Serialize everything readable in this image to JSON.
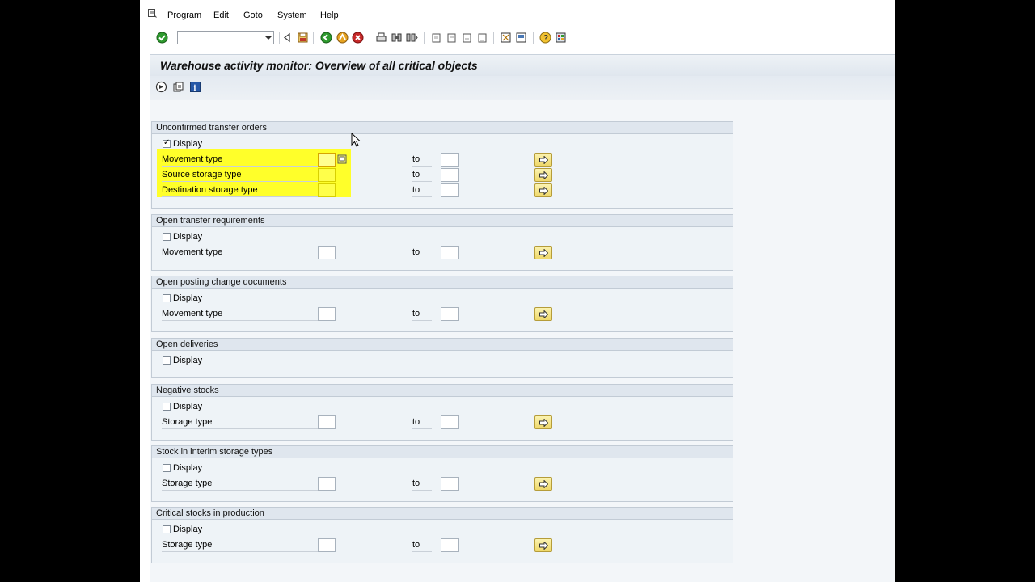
{
  "menu": [
    {
      "name": "program",
      "label": "Program"
    },
    {
      "name": "edit",
      "label": "Edit"
    },
    {
      "name": "goto",
      "label": "Goto"
    },
    {
      "name": "system",
      "label": "System"
    },
    {
      "name": "help",
      "label": "Help"
    }
  ],
  "toolbar": {
    "command_field_value": "",
    "icons": [
      "enter-icon",
      "save-icon",
      "back-icon",
      "exit-icon",
      "cancel-icon",
      "print-icon",
      "find-icon",
      "find-next-icon",
      "first-page-icon",
      "previous-page-icon",
      "next-page-icon",
      "last-page-icon",
      "create-session-icon",
      "shortcut-icon",
      "help-icon",
      "layout-menu-icon"
    ]
  },
  "title": "Warehouse activity monitor: Overview of all critical objects",
  "app_toolbar_icons": [
    "execute-icon",
    "get-variant-icon",
    "information-icon"
  ],
  "colors": {
    "highlight": "#ffff2a",
    "select_button": "#efd86a",
    "group_header": "#dfe6ee"
  },
  "groups": [
    {
      "name": "unconfirmed-transfer-orders",
      "header": "Unconfirmed transfer orders",
      "display_label": "Display",
      "display_checked": true,
      "rows": [
        {
          "label": "Movement type",
          "to": "to"
        },
        {
          "label": "Source storage type",
          "to": "to"
        },
        {
          "label": "Destination storage type",
          "to": "to"
        }
      ]
    },
    {
      "name": "open-transfer-requirements",
      "header": "Open transfer requirements",
      "display_label": "Display",
      "display_checked": false,
      "rows": [
        {
          "label": "Movement type",
          "to": "to"
        }
      ]
    },
    {
      "name": "open-posting-change-documents",
      "header": "Open posting change documents",
      "display_label": "Display",
      "display_checked": false,
      "rows": [
        {
          "label": "Movement type",
          "to": "to"
        }
      ]
    },
    {
      "name": "open-deliveries",
      "header": "Open deliveries",
      "display_label": "Display",
      "display_checked": false,
      "rows": []
    },
    {
      "name": "negative-stocks",
      "header": "Negative stocks",
      "display_label": "Display",
      "display_checked": false,
      "rows": [
        {
          "label": "Storage type",
          "to": "to"
        }
      ]
    },
    {
      "name": "stock-in-interim-storage-types",
      "header": "Stock in interim storage types",
      "display_label": "Display",
      "display_checked": false,
      "rows": [
        {
          "label": "Storage type",
          "to": "to"
        }
      ]
    },
    {
      "name": "critical-stocks-in-production",
      "header": "Critical stocks in production",
      "display_label": "Display",
      "display_checked": false,
      "rows": [
        {
          "label": "Storage type",
          "to": "to"
        }
      ]
    }
  ]
}
